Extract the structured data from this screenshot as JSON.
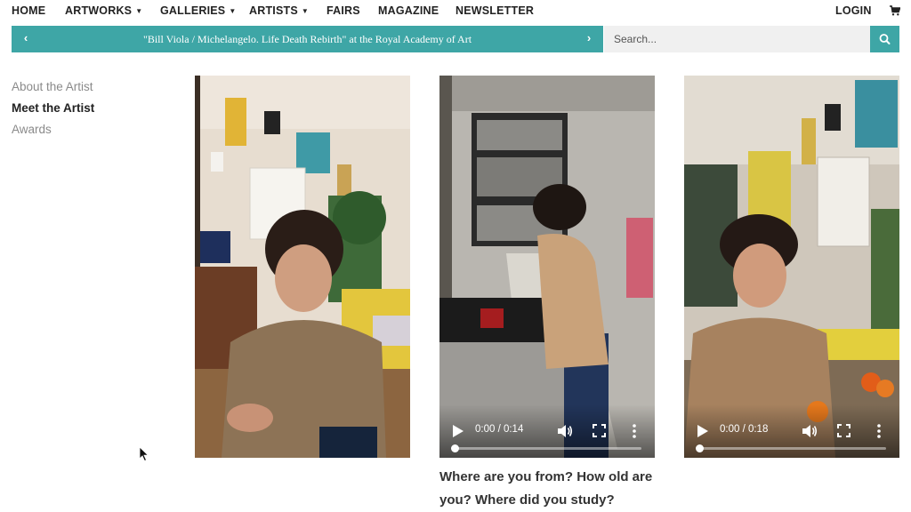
{
  "nav": {
    "items": [
      {
        "label": "HOME"
      },
      {
        "label": "ARTWORKS"
      },
      {
        "label": "GALLERIES"
      },
      {
        "label": "ARTISTS"
      },
      {
        "label": "FAIRS"
      },
      {
        "label": "MAGAZINE"
      },
      {
        "label": "NEWSLETTER"
      }
    ],
    "login_label": "LOGIN",
    "cart_icon": "cart-icon"
  },
  "announcement": {
    "text": "\"Bill Viola / Michelangelo. Life Death Rebirth\" at the Royal Academy of Art",
    "prev_icon": "chevron-left-icon",
    "next_icon": "chevron-right-icon"
  },
  "search": {
    "placeholder": "Search...",
    "button_icon": "search-icon"
  },
  "sidebar": {
    "items": [
      {
        "label": "About the Artist"
      },
      {
        "label": "Meet the Artist"
      },
      {
        "label": "Awards"
      }
    ],
    "active_index": 1
  },
  "videos": [
    {
      "time": "",
      "progress": 0
    },
    {
      "time": "0:00 / 0:14",
      "progress": 0
    },
    {
      "time": "0:00 / 0:18",
      "progress": 0
    }
  ],
  "question": "Where are you from? How old are you? Where did you study?",
  "colors": {
    "accent": "#3ea6a6",
    "text": "#222222",
    "muted": "#8a8a8a",
    "search_bg": "#f0f0f0"
  }
}
